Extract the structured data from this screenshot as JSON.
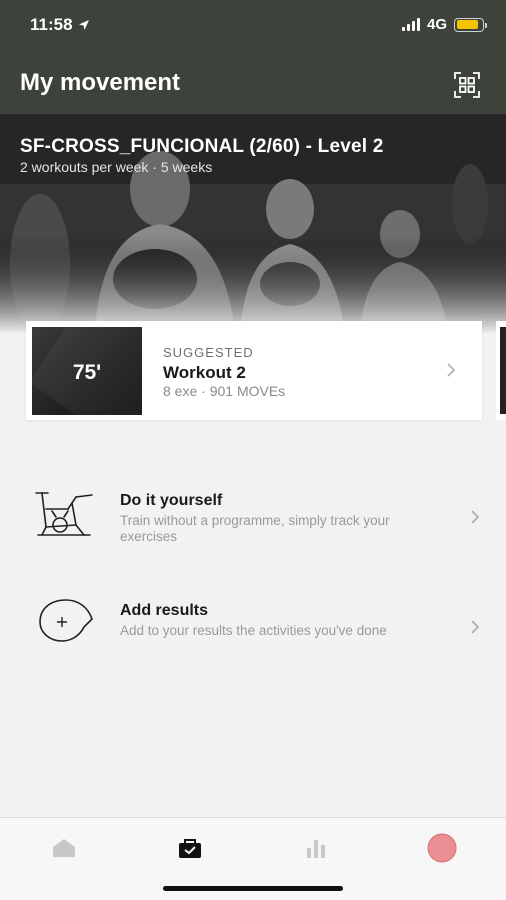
{
  "status_bar": {
    "time": "11:58",
    "network": "4G",
    "location_icon": "location-arrow-icon",
    "battery_level": 0.85,
    "battery_color": "#f5c400"
  },
  "header": {
    "title": "My movement",
    "scan_icon": "qr-scan-icon",
    "background_color": "#3d423a"
  },
  "program": {
    "title": "SF-CROSS_FUNCIONAL (2/60) - Level 2",
    "subtitle": "2 workouts per week · 5 weeks"
  },
  "suggested_workout": {
    "duration": "75'",
    "tag": "SUGGESTED",
    "name": "Workout 2",
    "meta": "8 exe · 901 MOVEs"
  },
  "actions": [
    {
      "title": "Do it yourself",
      "description": "Train without a programme, simply track your exercises",
      "icon": "exercise-bike-icon"
    },
    {
      "title": "Add results",
      "description": "Add to your results the activities you've done",
      "icon": "add-result-icon"
    }
  ],
  "tab_bar": {
    "tabs": [
      {
        "icon": "home-icon",
        "active": false
      },
      {
        "icon": "workout-bag-icon",
        "active": true
      },
      {
        "icon": "stats-icon",
        "active": false
      },
      {
        "icon": "profile-avatar-icon",
        "active": false
      }
    ],
    "active_color": "#111111",
    "inactive_color": "#c8c8c8",
    "profile_color": "#e98f93"
  }
}
